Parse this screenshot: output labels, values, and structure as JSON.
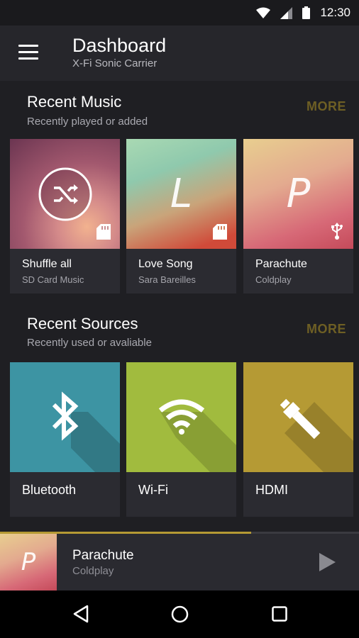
{
  "status_bar": {
    "time": "12:30"
  },
  "app_bar": {
    "title": "Dashboard",
    "subtitle": "X-Fi Sonic Carrier"
  },
  "recent_music": {
    "title": "Recent Music",
    "subtitle": "Recently played or added",
    "more_label": "MORE",
    "items": [
      {
        "title": "Shuffle all",
        "subtitle": "SD Card Music",
        "art_letter": "",
        "badge_icon": "sd-card-icon"
      },
      {
        "title": "Love Song",
        "subtitle": "Sara Bareilles",
        "art_letter": "L",
        "badge_icon": "sd-card-icon"
      },
      {
        "title": "Parachute",
        "subtitle": "Coldplay",
        "art_letter": "P",
        "badge_icon": "usb-icon"
      }
    ]
  },
  "recent_sources": {
    "title": "Recent Sources",
    "subtitle": "Recently used or avaliable",
    "more_label": "MORE",
    "items": [
      {
        "label": "Bluetooth",
        "icon": "bluetooth-icon",
        "color": "#3d94a3"
      },
      {
        "label": "Wi-Fi",
        "icon": "wifi-icon",
        "color": "#a1bb3e"
      },
      {
        "label": "HDMI",
        "icon": "hdmi-icon",
        "color": "#b59a34"
      }
    ]
  },
  "now_playing": {
    "art_letter": "P",
    "title": "Parachute",
    "artist": "Coldplay",
    "progress": 0.7
  },
  "colors": {
    "accent": "#b59a34",
    "more_text": "#6e5f24",
    "background": "#1f1f23"
  }
}
